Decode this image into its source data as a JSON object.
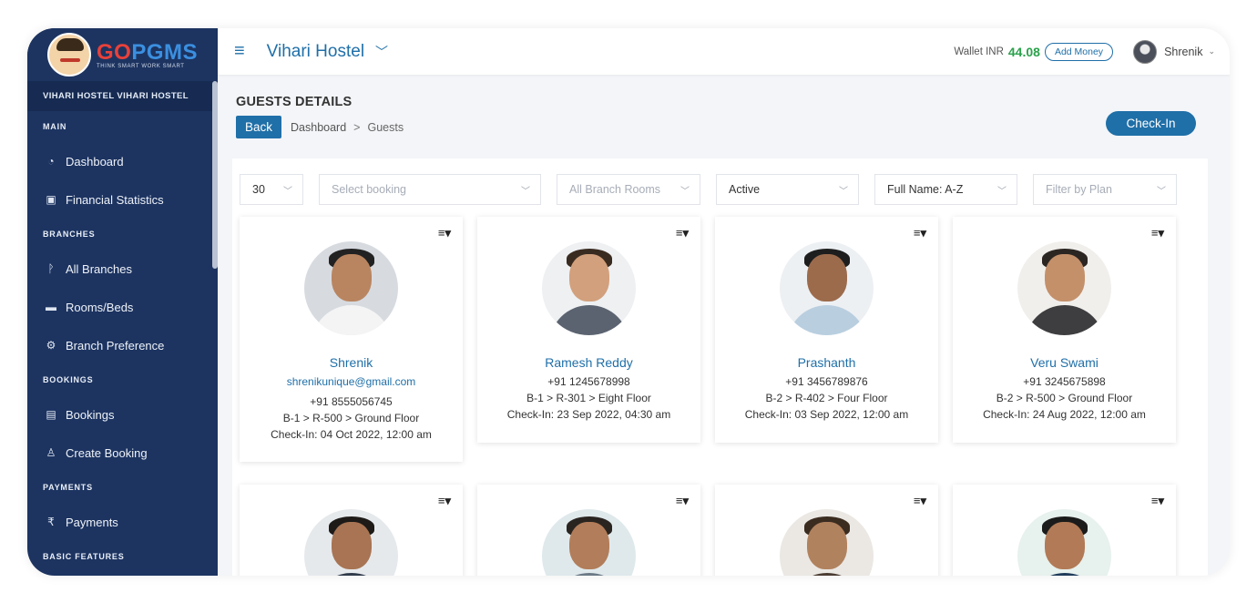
{
  "brand": {
    "logo_main_go": "GO",
    "logo_main_rest": "PGMS",
    "tagline": "THINK SMART WORK SMART"
  },
  "sidebar": {
    "hostel_label": "VIHARI HOSTEL VIHARI HOSTEL",
    "sections": [
      {
        "title": "MAIN",
        "items": [
          {
            "label": "Dashboard",
            "icon": "gauge-icon"
          },
          {
            "label": "Financial Statistics",
            "icon": "money-icon"
          }
        ]
      },
      {
        "title": "BRANCHES",
        "items": [
          {
            "label": "All Branches",
            "icon": "branch-icon"
          },
          {
            "label": "Rooms/Beds",
            "icon": "bed-icon"
          },
          {
            "label": "Branch Preference",
            "icon": "cogs-icon"
          }
        ]
      },
      {
        "title": "BOOKINGS",
        "items": [
          {
            "label": "Bookings",
            "icon": "book-icon"
          },
          {
            "label": "Create Booking",
            "icon": "user-icon"
          }
        ]
      },
      {
        "title": "PAYMENTS",
        "items": [
          {
            "label": "Payments",
            "icon": "rupee-icon"
          }
        ]
      },
      {
        "title": "BASIC FEATURES",
        "items": []
      }
    ]
  },
  "header": {
    "hostel_name": "Vihari Hostel",
    "wallet_label": "Wallet INR",
    "wallet_amount": "44.08",
    "add_money_label": "Add Money",
    "user_name": "Shrenik"
  },
  "page": {
    "title": "GUESTS DETAILS",
    "back_label": "Back",
    "breadcrumb": [
      "Dashboard",
      "Guests"
    ],
    "breadcrumb_sep": ">",
    "checkin_label": "Check-In"
  },
  "filters": [
    {
      "value": "30",
      "placeholder": false
    },
    {
      "value": "Select booking",
      "placeholder": true
    },
    {
      "value": "All Branch Rooms",
      "placeholder": true
    },
    {
      "value": "Active",
      "placeholder": false
    },
    {
      "value": "Full Name: A-Z",
      "placeholder": false
    },
    {
      "value": "Filter by Plan",
      "placeholder": true
    }
  ],
  "guests": [
    {
      "name": "Shrenik",
      "email": "shrenikunique@gmail.com",
      "phone": "+91 8555056745",
      "room": "B-1 > R-500 > Ground Floor",
      "checkin": "Check-In: 04 Oct 2022, 12:00 am"
    },
    {
      "name": "Ramesh Reddy",
      "phone": "+91 1245678998",
      "room": "B-1 > R-301 > Eight Floor",
      "checkin": "Check-In: 23 Sep 2022, 04:30 am"
    },
    {
      "name": "Prashanth",
      "phone": "+91 3456789876",
      "room": "B-2 > R-402 > Four Floor",
      "checkin": "Check-In: 03 Sep 2022, 12:00 am"
    },
    {
      "name": "Veru Swami",
      "phone": "+91 3245675898",
      "room": "B-2 > R-500 > Ground Floor",
      "checkin": "Check-In: 24 Aug 2022, 12:00 am"
    }
  ],
  "colors": {
    "sidebar": "#1d3461",
    "accent": "#1f6fa8",
    "wallet_amount": "#2aa14b"
  }
}
